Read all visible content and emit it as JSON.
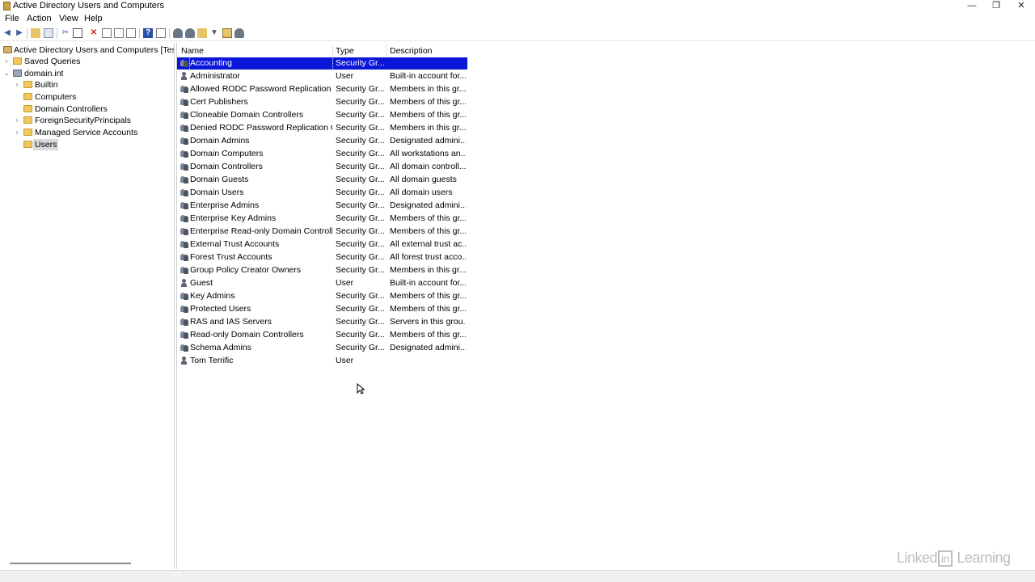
{
  "window": {
    "title": "Active Directory Users and Computers",
    "minimize_glyph": "—",
    "maximize_glyph": "❐",
    "close_glyph": "✕"
  },
  "menu": [
    "File",
    "Action",
    "View",
    "Help"
  ],
  "toolbar": {
    "icons": [
      "back-arrow-icon",
      "forward-arrow-icon",
      "up-folder-icon",
      "show-hide-console-tree-icon",
      "cut-icon",
      "copy-icon",
      "delete-icon",
      "properties-icon",
      "refresh-icon",
      "export-list-icon",
      "help-icon",
      "action-pane-icon",
      "new-user-icon",
      "new-group-icon",
      "new-ou-icon",
      "filter-icon",
      "find-icon",
      "add-to-group-icon"
    ],
    "back_glyph": "◀",
    "forward_glyph": "▶",
    "delete_glyph": "✕",
    "help_glyph": "?",
    "filter_glyph": "▼"
  },
  "tree": {
    "root": "Active Directory Users and Computers [TestD",
    "items": [
      {
        "label": "Saved Queries",
        "expander": "›"
      },
      {
        "label": "domain.int",
        "expander": "⌄"
      },
      {
        "label": "Builtin",
        "expander": "›"
      },
      {
        "label": "Computers",
        "expander": ""
      },
      {
        "label": "Domain Controllers",
        "expander": ""
      },
      {
        "label": "ForeignSecurityPrincipals",
        "expander": "›"
      },
      {
        "label": "Managed Service Accounts",
        "expander": "›"
      },
      {
        "label": "Users",
        "expander": ""
      }
    ]
  },
  "list": {
    "columns": [
      "Name",
      "Type",
      "Description"
    ],
    "rows": [
      {
        "name": "Accounting",
        "type": "Security Gr...",
        "desc": "",
        "kind": "group"
      },
      {
        "name": "Administrator",
        "type": "User",
        "desc": "Built-in account for...",
        "kind": "user"
      },
      {
        "name": "Allowed RODC Password Replication ...",
        "type": "Security Gr...",
        "desc": "Members in this gr...",
        "kind": "group"
      },
      {
        "name": "Cert Publishers",
        "type": "Security Gr...",
        "desc": "Members of this gr...",
        "kind": "group"
      },
      {
        "name": "Cloneable Domain Controllers",
        "type": "Security Gr...",
        "desc": "Members of this gr...",
        "kind": "group"
      },
      {
        "name": "Denied RODC Password Replication G...",
        "type": "Security Gr...",
        "desc": "Members in this gr...",
        "kind": "group"
      },
      {
        "name": "Domain Admins",
        "type": "Security Gr...",
        "desc": "Designated admini...",
        "kind": "group"
      },
      {
        "name": "Domain Computers",
        "type": "Security Gr...",
        "desc": "All workstations an...",
        "kind": "group"
      },
      {
        "name": "Domain Controllers",
        "type": "Security Gr...",
        "desc": "All domain controll...",
        "kind": "group"
      },
      {
        "name": "Domain Guests",
        "type": "Security Gr...",
        "desc": "All domain guests",
        "kind": "group"
      },
      {
        "name": "Domain Users",
        "type": "Security Gr...",
        "desc": "All domain users",
        "kind": "group"
      },
      {
        "name": "Enterprise Admins",
        "type": "Security Gr...",
        "desc": "Designated admini...",
        "kind": "group"
      },
      {
        "name": "Enterprise Key Admins",
        "type": "Security Gr...",
        "desc": "Members of this gr...",
        "kind": "group"
      },
      {
        "name": "Enterprise Read-only Domain Controll...",
        "type": "Security Gr...",
        "desc": "Members of this gr...",
        "kind": "group"
      },
      {
        "name": "External Trust Accounts",
        "type": "Security Gr...",
        "desc": "All external trust ac...",
        "kind": "group"
      },
      {
        "name": "Forest Trust Accounts",
        "type": "Security Gr...",
        "desc": "All forest trust acco...",
        "kind": "group"
      },
      {
        "name": "Group Policy Creator Owners",
        "type": "Security Gr...",
        "desc": "Members in this gr...",
        "kind": "group"
      },
      {
        "name": "Guest",
        "type": "User",
        "desc": "Built-in account for...",
        "kind": "user"
      },
      {
        "name": "Key Admins",
        "type": "Security Gr...",
        "desc": "Members of this gr...",
        "kind": "group"
      },
      {
        "name": "Protected Users",
        "type": "Security Gr...",
        "desc": "Members of this gr...",
        "kind": "group"
      },
      {
        "name": "RAS and IAS Servers",
        "type": "Security Gr...",
        "desc": "Servers in this grou...",
        "kind": "group"
      },
      {
        "name": "Read-only Domain Controllers",
        "type": "Security Gr...",
        "desc": "Members of this gr...",
        "kind": "group"
      },
      {
        "name": "Schema Admins",
        "type": "Security Gr...",
        "desc": "Designated admini...",
        "kind": "group"
      },
      {
        "name": "Tom Terrific",
        "type": "User",
        "desc": "",
        "kind": "user"
      }
    ]
  },
  "watermark": {
    "text_a": "Linked",
    "text_b": "in",
    "text_c": " Learning"
  },
  "colors": {
    "selection": "#0a16d8",
    "accent_blue": "#3a5f9a"
  }
}
